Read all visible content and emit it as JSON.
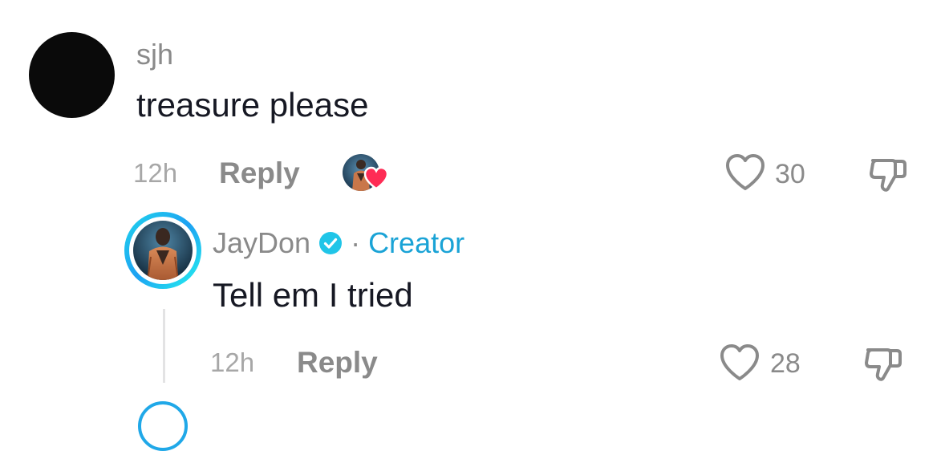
{
  "comment": {
    "username": "sjh",
    "text": "treasure please",
    "time": "12h",
    "reply_label": "Reply",
    "likes": "30",
    "creator_liked": true
  },
  "reply": {
    "username": "JayDon",
    "badge": "Creator",
    "separator": "·",
    "text": "Tell em I tried",
    "time": "12h",
    "reply_label": "Reply",
    "likes": "28",
    "verified": true
  },
  "colors": {
    "text": "#161823",
    "muted": "#8a8a8a",
    "creator": "#1aa3d6",
    "verified": "#20c5e8",
    "heart_badge": "#fe2c55"
  },
  "icons": {
    "like": "heart-outline-icon",
    "dislike": "thumbs-down-outline-icon",
    "verified": "verified-check-icon",
    "creator_like": "heart-filled-icon"
  }
}
